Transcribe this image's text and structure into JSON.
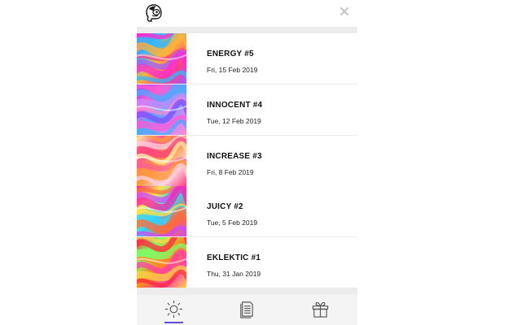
{
  "header": {
    "logo_icon": "monkey-logo-icon",
    "close_icon": "close-icon",
    "close_color": "#c4c4c4"
  },
  "items": [
    {
      "title": "ENERGY #5",
      "date": "Fri, 15 Feb 2019",
      "colors": [
        "#ff2bd0",
        "#2fb8ff",
        "#ffb23a",
        "#ff3e8a",
        "#9d5cff"
      ]
    },
    {
      "title": "INNOCENT #4",
      "date": "Tue, 12 Feb 2019",
      "colors": [
        "#7d4dff",
        "#ff5ad2",
        "#4fa9ff",
        "#c58bff",
        "#ff8ad0"
      ]
    },
    {
      "title": "INCREASE #3",
      "date": "Fri, 8 Feb 2019",
      "colors": [
        "#fff3a6",
        "#ff5e93",
        "#ff9a3d",
        "#ffd0e0",
        "#ff3f7a"
      ]
    },
    {
      "title": "JUICY #2",
      "date": "Tue, 5 Feb 2019",
      "colors": [
        "#ff1fa6",
        "#ffe14a",
        "#2fd2ff",
        "#ff6b3a",
        "#c84bff"
      ]
    },
    {
      "title": "EKLEKTIC #1",
      "date": "Thu, 31 Jan 2019",
      "colors": [
        "#ff2a3d",
        "#7cff6a",
        "#ff8a1e",
        "#ff3fa6",
        "#ffd34a"
      ]
    }
  ],
  "bottom_nav": {
    "accent_color": "#5a4fd6",
    "icon_color": "#555555",
    "tabs": [
      {
        "icon": "sun-icon",
        "active": true
      },
      {
        "icon": "document-icon",
        "active": false
      },
      {
        "icon": "gift-icon",
        "active": false
      }
    ]
  }
}
